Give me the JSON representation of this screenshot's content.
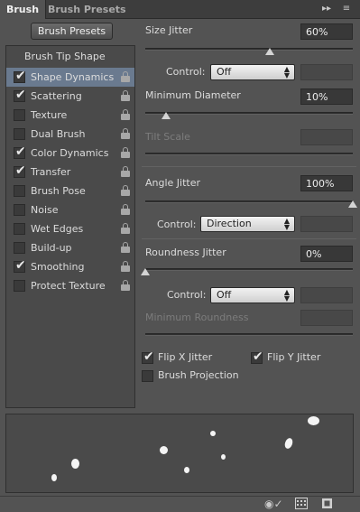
{
  "tabs": [
    {
      "label": "Brush"
    },
    {
      "label": "Brush Presets"
    }
  ],
  "header_icons": [
    "collapse-icon",
    "panel-menu-icon"
  ],
  "brush_presets_button": "Brush Presets",
  "options_list": {
    "heading": "Brush Tip Shape",
    "items": [
      {
        "label": "Shape Dynamics",
        "checked": true,
        "selected": true
      },
      {
        "label": "Scattering",
        "checked": true
      },
      {
        "label": "Texture",
        "checked": false
      },
      {
        "label": "Dual Brush",
        "checked": false
      },
      {
        "label": "Color Dynamics",
        "checked": true
      },
      {
        "label": "Transfer",
        "checked": true
      },
      {
        "label": "Brush Pose",
        "checked": false
      },
      {
        "label": "Noise",
        "checked": false
      },
      {
        "label": "Wet Edges",
        "checked": false
      },
      {
        "label": "Build-up",
        "checked": false
      },
      {
        "label": "Smoothing",
        "checked": true
      },
      {
        "label": "Protect Texture",
        "checked": false
      }
    ]
  },
  "settings": {
    "size_jitter": {
      "label": "Size Jitter",
      "value": "60%",
      "slider_fraction": 0.6
    },
    "size_control": {
      "label": "Control:",
      "value": "Off"
    },
    "minimum_diameter": {
      "label": "Minimum Diameter",
      "value": "10%",
      "slider_fraction": 0.1
    },
    "tilt_scale": {
      "label": "Tilt Scale"
    },
    "angle_jitter": {
      "label": "Angle Jitter",
      "value": "100%",
      "slider_fraction": 1.0
    },
    "angle_control": {
      "label": "Control:",
      "value": "Direction"
    },
    "roundness_jitter": {
      "label": "Roundness Jitter",
      "value": "0%",
      "slider_fraction": 0.0
    },
    "roundness_control": {
      "label": "Control:",
      "value": "Off"
    },
    "minimum_roundness": {
      "label": "Minimum Roundness"
    },
    "flip_x": {
      "label": "Flip X Jitter",
      "checked": true
    },
    "flip_y": {
      "label": "Flip Y Jitter",
      "checked": true
    },
    "brush_projection": {
      "label": "Brush Projection",
      "checked": false
    }
  },
  "bottom_icons": [
    "eye-brush-icon",
    "grid-icon",
    "new-brush-icon"
  ]
}
